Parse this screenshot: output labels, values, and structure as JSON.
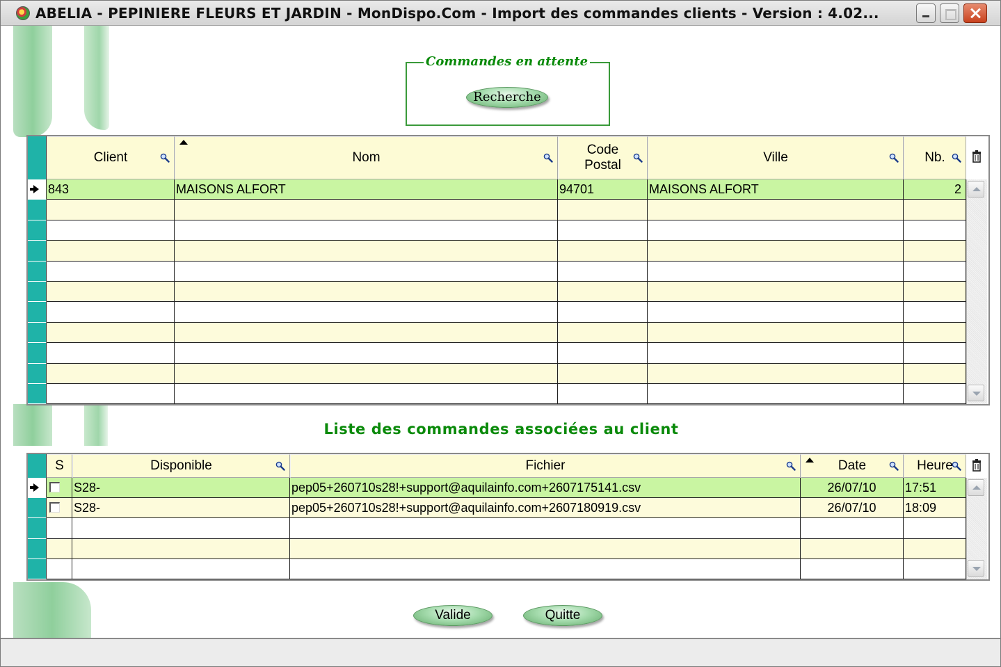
{
  "window": {
    "title": "ABELIA  -  PEPINIERE FLEURS ET JARDIN  -  MonDispo.Com - Import des commandes clients  -  Version : 4.02..."
  },
  "group": {
    "title": "Commandes en attente",
    "search_label": "Recherche"
  },
  "clients_table": {
    "columns": [
      "Client",
      "Nom",
      "Code\nPostal",
      "Ville",
      "Nb."
    ],
    "sorted_column": "Nom",
    "rows": [
      {
        "client": "843",
        "nom": "MAISONS ALFORT",
        "cp": "94701",
        "ville": "MAISONS ALFORT",
        "nb": "2",
        "selected": true
      }
    ],
    "total_visible_rows": 11
  },
  "orders_section": {
    "title": "Liste des commandes associées au client"
  },
  "orders_table": {
    "columns": [
      "S",
      "Disponible",
      "Fichier",
      "Date",
      "Heure"
    ],
    "sorted_column": "Date",
    "rows": [
      {
        "s": false,
        "disponible": "S28-",
        "fichier": "pep05+260710s28!+support@aquilainfo.com+2607175141.csv",
        "date": "26/07/10",
        "heure": "17:51",
        "selected": true
      },
      {
        "s": false,
        "disponible": "S28-",
        "fichier": "pep05+260710s28!+support@aquilainfo.com+2607180919.csv",
        "date": "26/07/10",
        "heure": "18:09",
        "selected": false
      }
    ],
    "total_visible_rows": 5
  },
  "buttons": {
    "valide": "Valide",
    "quitte": "Quitte"
  },
  "colors": {
    "accent_green": "#0a8a0a",
    "selected_row": "#c9f5a2",
    "header_bg": "#fdfbd5",
    "row_selector": "#1fb3a8"
  }
}
